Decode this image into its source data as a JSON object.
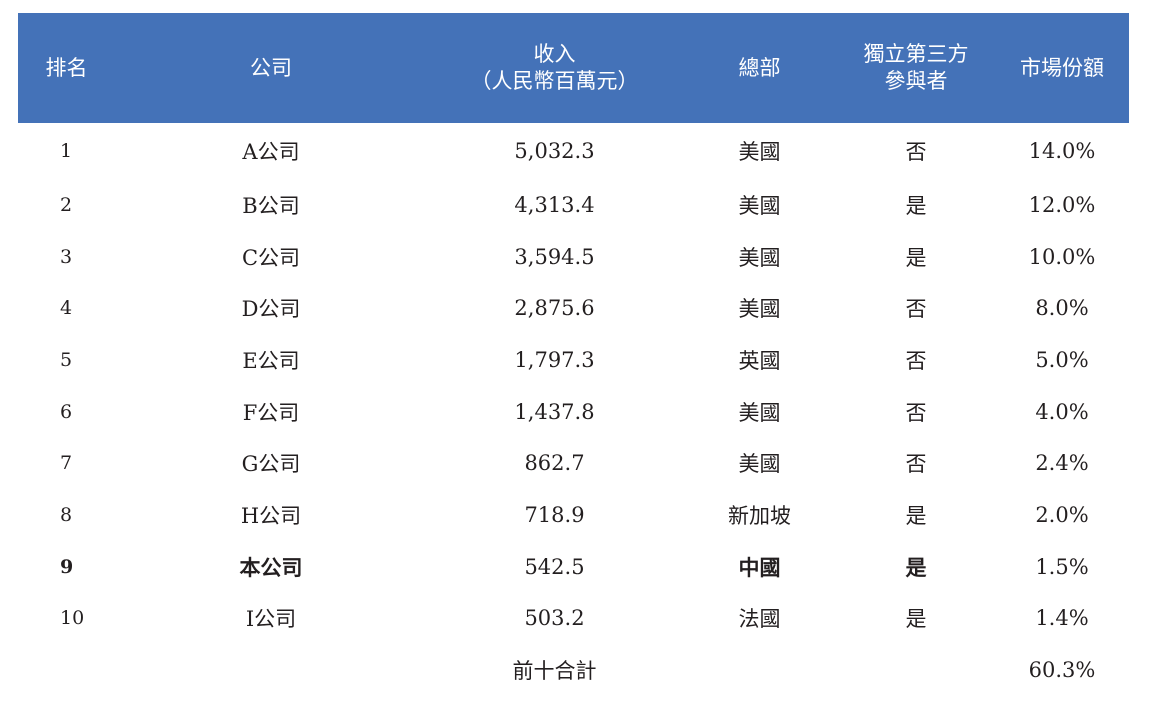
{
  "header": {
    "rank": "排名",
    "company": "公司",
    "revenue_line1": "收入",
    "revenue_line2": "（人民幣百萬元）",
    "hq": "總部",
    "independent_line1": "獨立第三方",
    "independent_line2": "參與者",
    "share": "市場份額"
  },
  "rows": [
    {
      "rank": "1",
      "company": "A公司",
      "revenue": "5,032.3",
      "hq": "美國",
      "independent": "否",
      "share": "14.0%"
    },
    {
      "rank": "2",
      "company": "B公司",
      "revenue": "4,313.4",
      "hq": "美國",
      "independent": "是",
      "share": "12.0%"
    },
    {
      "rank": "3",
      "company": "C公司",
      "revenue": "3,594.5",
      "hq": "美國",
      "independent": "是",
      "share": "10.0%"
    },
    {
      "rank": "4",
      "company": "D公司",
      "revenue": "2,875.6",
      "hq": "美國",
      "independent": "否",
      "share": "8.0%"
    },
    {
      "rank": "5",
      "company": "E公司",
      "revenue": "1,797.3",
      "hq": "英國",
      "independent": "否",
      "share": "5.0%"
    },
    {
      "rank": "6",
      "company": "F公司",
      "revenue": "1,437.8",
      "hq": "美國",
      "independent": "否",
      "share": "4.0%"
    },
    {
      "rank": "7",
      "company": "G公司",
      "revenue": "862.7",
      "hq": "美國",
      "independent": "否",
      "share": "2.4%"
    },
    {
      "rank": "8",
      "company": "H公司",
      "revenue": "718.9",
      "hq": "新加坡",
      "independent": "是",
      "share": "2.0%"
    },
    {
      "rank": "9",
      "company": "本公司",
      "revenue": "542.5",
      "hq": "中國",
      "independent": "是",
      "share": "1.5%"
    },
    {
      "rank": "10",
      "company": "I公司",
      "revenue": "503.2",
      "hq": "法國",
      "independent": "是",
      "share": "1.4%"
    }
  ],
  "total": {
    "label": "前十合計",
    "share": "60.3%"
  },
  "colors": {
    "header_bg": "#4472b8",
    "header_text": "#ffffff",
    "body_text": "#231f20"
  }
}
